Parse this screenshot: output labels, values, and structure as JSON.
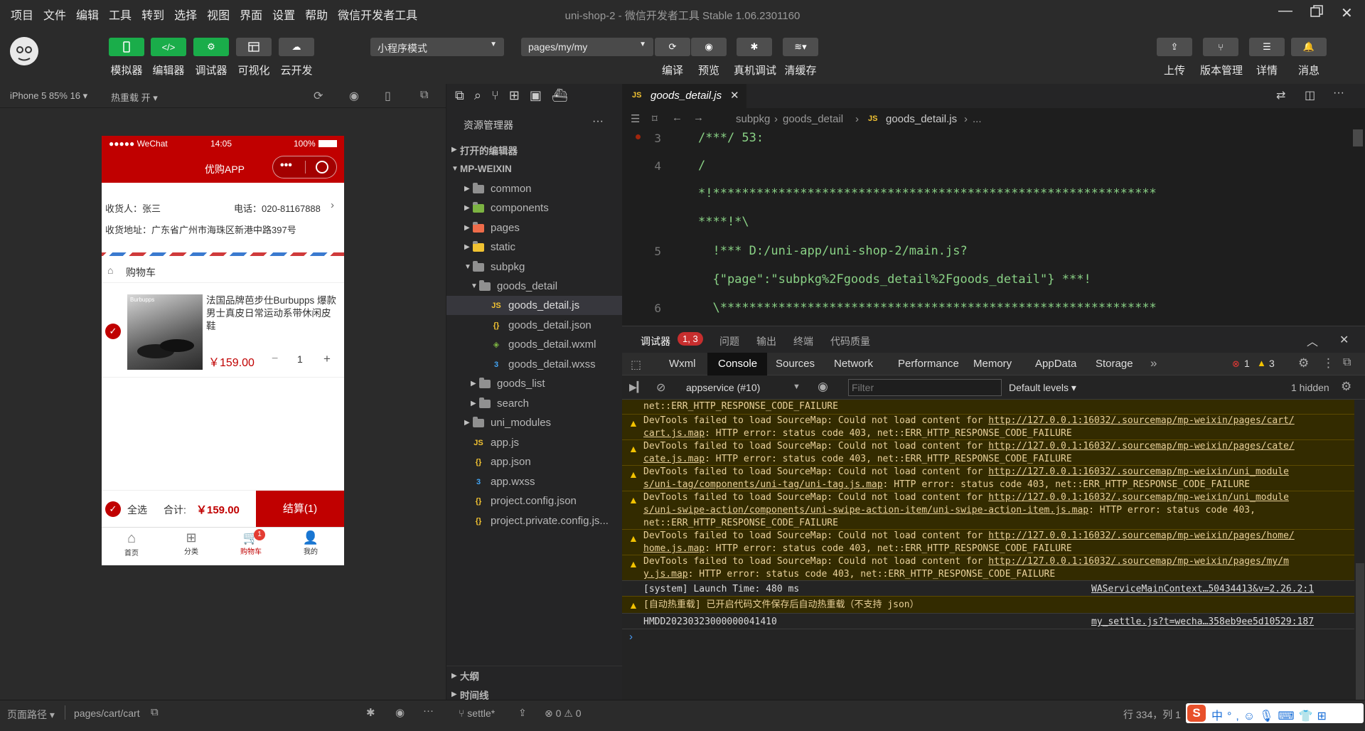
{
  "menu": [
    "项目",
    "文件",
    "编辑",
    "工具",
    "转到",
    "选择",
    "视图",
    "界面",
    "设置",
    "帮助",
    "微信开发者工具"
  ],
  "window_title": "uni-shop-2 - 微信开发者工具 Stable 1.06.2301160",
  "toolbar": {
    "left": [
      "模拟器",
      "编辑器",
      "调试器",
      "可视化",
      "云开发"
    ],
    "mode": "小程序模式",
    "page": "pages/my/my",
    "middle": [
      "编译",
      "预览",
      "真机调试",
      "清缓存"
    ],
    "right": [
      "上传",
      "版本管理",
      "详情",
      "消息"
    ]
  },
  "sim": {
    "device": "iPhone 5 85% 16",
    "hotreload": "热重载 开"
  },
  "phone": {
    "carrier": "●●●●● WeChat",
    "time": "14:05",
    "battery": "100%",
    "nav_title": "优购APP",
    "receiver_label": "收货人：张三",
    "phone_label": "电话：020-81167888",
    "address_label": "收货地址：广东省广州市海珠区新港中路397号",
    "cart_title": "购物车",
    "goods_name": "法国品牌芭步仕Burbupps 爆款男士真皮日常运动系带休闲皮鞋",
    "goods_brand": "Burbupps",
    "goods_price": "￥159.00",
    "goods_count": "1",
    "minus": "−",
    "plus": "+",
    "select_all": "全选",
    "total_label": "合计:",
    "total_value": "￥159.00",
    "settle_btn": "结算(1)",
    "tabs": [
      "首页",
      "分类",
      "购物车",
      "我的"
    ],
    "badge": "1"
  },
  "explorer": {
    "title": "资源管理器",
    "open_editors": "打开的编辑器",
    "root": "MP-WEIXIN",
    "items": [
      "common",
      "components",
      "pages",
      "static",
      "subpkg",
      "goods_detail",
      "goods_detail.js",
      "goods_detail.json",
      "goods_detail.wxml",
      "goods_detail.wxss",
      "goods_list",
      "search",
      "uni_modules",
      "app.js",
      "app.json",
      "app.wxss",
      "project.config.json",
      "project.private.config.js..."
    ],
    "outline": "大纲",
    "timeline": "时间线"
  },
  "editor": {
    "tab": "goods_detail.js",
    "breadcrumb": [
      "subpkg",
      "goods_detail",
      "goods_detail.js",
      "..."
    ],
    "lines": [
      {
        "n": "3",
        "t": "/***/ 53:"
      },
      {
        "n": "4",
        "t": "/"
      },
      {
        "n": "",
        "t": "*!*************************************************************"
      },
      {
        "n": "",
        "t": "****!*\\"
      },
      {
        "n": "5",
        "t": "  !*** D:/uni-app/uni-shop-2/main.js?"
      },
      {
        "n": "",
        "t": "  {\"page\":\"subpkg%2Fgoods_detail%2Fgoods_detail\"} ***!"
      },
      {
        "n": "6",
        "t": "  \\************************************************************"
      }
    ]
  },
  "devtools": {
    "panel_tabs": [
      "调试器",
      "问题",
      "输出",
      "终端",
      "代码质量"
    ],
    "panel_badge": "1, 3",
    "tabs": [
      "Wxml",
      "Console",
      "Sources",
      "Network",
      "Performance",
      "Memory",
      "AppData",
      "Storage"
    ],
    "err_count": "1",
    "warn_count": "3",
    "context": "appservice (#10)",
    "filter_placeholder": "Filter",
    "levels": "Default levels",
    "hidden": "1 hidden",
    "first_line": "net::ERR_HTTP_RESPONSE_CODE_FAILURE",
    "warnings": [
      {
        "a": "DevTools failed to load SourceMap: Could not load content for ",
        "u1": "http://127.0.0.1:16032/.sourcemap/mp-weixin/pages/cart/",
        "u2": "cart.js.map",
        "b": ": HTTP error: status code 403, net::ERR_HTTP_RESPONSE_CODE_FAILURE",
        "c": ""
      },
      {
        "a": "DevTools failed to load SourceMap: Could not load content for ",
        "u1": "http://127.0.0.1:16032/.sourcemap/mp-weixin/pages/cate/",
        "u2": "cate.js.map",
        "b": ": HTTP error: status code 403, net::ERR_HTTP_RESPONSE_CODE_FAILURE",
        "c": ""
      },
      {
        "a": "DevTools failed to load SourceMap: Could not load content for ",
        "u1": "http://127.0.0.1:16032/.sourcemap/mp-weixin/uni_module",
        "u2": "s/uni-tag/components/uni-tag/uni-tag.js.map",
        "b": ": HTTP error: status code 403, net::ERR_HTTP_RESPONSE_CODE_FAILURE",
        "c": ""
      },
      {
        "a": "DevTools failed to load SourceMap: Could not load content for ",
        "u1": "http://127.0.0.1:16032/.sourcemap/mp-weixin/uni_module",
        "u2": "s/uni-swipe-action/components/uni-swipe-action-item/uni-swipe-action-item.js.map",
        "b": ": HTTP error: status code 403,",
        "c": "net::ERR_HTTP_RESPONSE_CODE_FAILURE"
      },
      {
        "a": "DevTools failed to load SourceMap: Could not load content for ",
        "u1": "http://127.0.0.1:16032/.sourcemap/mp-weixin/pages/home/",
        "u2": "home.js.map",
        "b": ": HTTP error: status code 403, net::ERR_HTTP_RESPONSE_CODE_FAILURE",
        "c": ""
      },
      {
        "a": "DevTools failed to load SourceMap: Could not load content for ",
        "u1": "http://127.0.0.1:16032/.sourcemap/mp-weixin/pages/my/m",
        "u2": "y.js.map",
        "b": ": HTTP error: status code 403, net::ERR_HTTP_RESPONSE_CODE_FAILURE",
        "c": ""
      }
    ],
    "system_line": "[system] Launch Time: 480 ms",
    "system_src": "WAServiceMainContext…50434413&v=2.26.2:1",
    "hotreload_line": "[自动热重载] 已开启代码文件保存后自动热重载（不支持 json）",
    "hmdd_line": "HMDD20230323000000041410",
    "hmdd_src": "my_settle.js?t=wecha…358eb9ee5d10529:187"
  },
  "status": {
    "path_label": "页面路径",
    "path": "pages/cart/cart",
    "branch": "settle*",
    "errors": "0",
    "warnings": "0",
    "cursor": "行 334，列 1"
  }
}
